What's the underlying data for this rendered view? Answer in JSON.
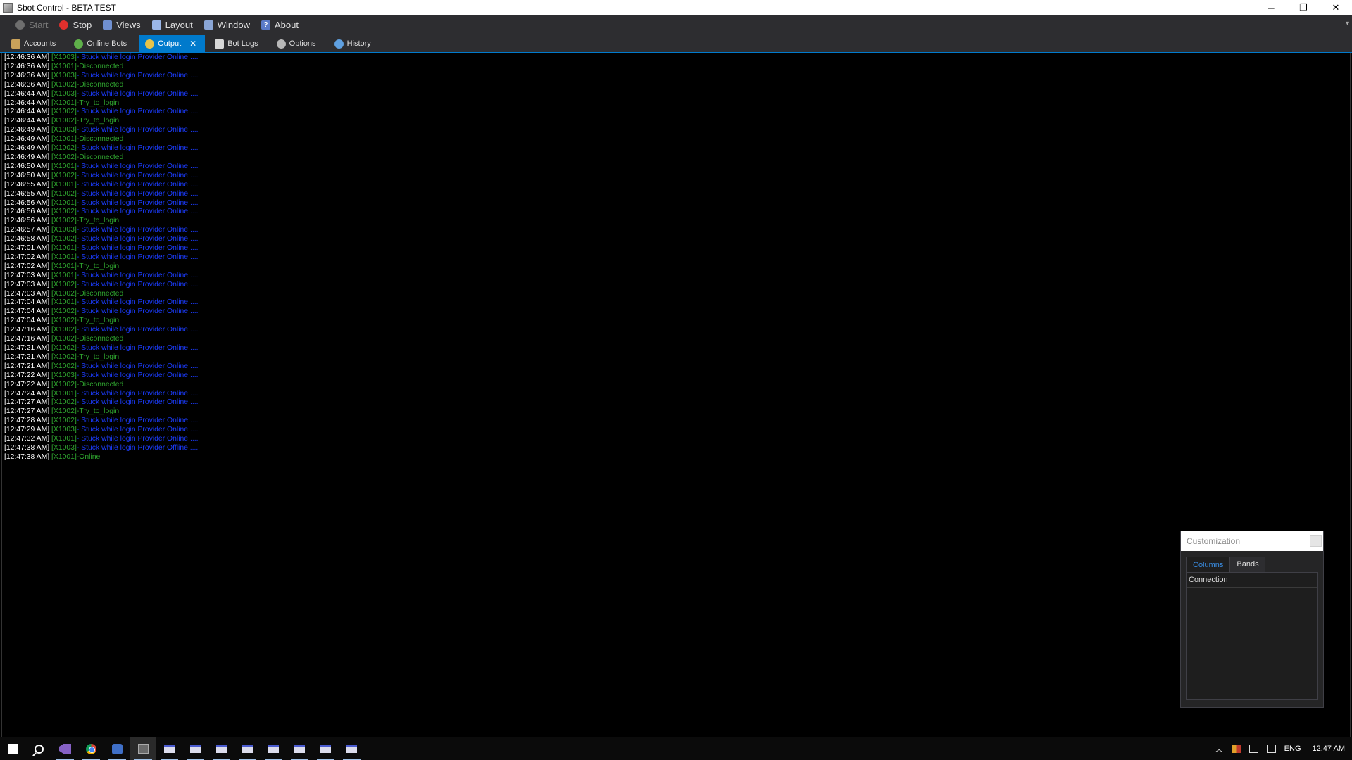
{
  "window": {
    "title": "Sbot Control - BETA TEST",
    "minimize": "─",
    "restore": "❐",
    "close": "✕"
  },
  "menu": [
    {
      "label": "Start",
      "icon": "start-icon",
      "enabled": false
    },
    {
      "label": "Stop",
      "icon": "stop-icon",
      "enabled": true
    },
    {
      "label": "Views",
      "icon": "views-icon",
      "enabled": true
    },
    {
      "label": "Layout",
      "icon": "layout-icon",
      "enabled": true
    },
    {
      "label": "Window",
      "icon": "window-icon",
      "enabled": true
    },
    {
      "label": "About",
      "icon": "about-icon",
      "enabled": true
    }
  ],
  "menu_overflow": "▾",
  "tabs": [
    {
      "label": "Accounts",
      "icon": "accounts-icon",
      "active": false
    },
    {
      "label": "Online Bots",
      "icon": "online-bots-icon",
      "active": false
    },
    {
      "label": "Output",
      "icon": "output-icon",
      "active": true
    },
    {
      "label": "Bot Logs",
      "icon": "bot-logs-icon",
      "active": false
    },
    {
      "label": "Options",
      "icon": "options-icon",
      "active": false
    },
    {
      "label": "History",
      "icon": "history-icon",
      "active": false
    }
  ],
  "tab_close": "✕",
  "tab_dropdown": "▼",
  "log": [
    {
      "time": "[12:46:36 AM]",
      "id": "[X1003]",
      "msg": "- Stuck while login Provider Online ....",
      "color": "blue"
    },
    {
      "time": "[12:46:36 AM]",
      "id": "[X1001]",
      "msg": "-Disconnected",
      "color": "green"
    },
    {
      "time": "[12:46:36 AM]",
      "id": "[X1003]",
      "msg": "- Stuck while login Provider Online ....",
      "color": "blue"
    },
    {
      "time": "[12:46:36 AM]",
      "id": "[X1002]",
      "msg": "-Disconnected",
      "color": "green"
    },
    {
      "time": "[12:46:44 AM]",
      "id": "[X1003]",
      "msg": "- Stuck while login Provider Online ....",
      "color": "blue"
    },
    {
      "time": "[12:46:44 AM]",
      "id": "[X1001]",
      "msg": "-Try_to_login",
      "color": "green"
    },
    {
      "time": "[12:46:44 AM]",
      "id": "[X1002]",
      "msg": "- Stuck while login Provider Online ....",
      "color": "blue"
    },
    {
      "time": "[12:46:44 AM]",
      "id": "[X1002]",
      "msg": "-Try_to_login",
      "color": "green"
    },
    {
      "time": "[12:46:49 AM]",
      "id": "[X1003]",
      "msg": "- Stuck while login Provider Online ....",
      "color": "blue"
    },
    {
      "time": "[12:46:49 AM]",
      "id": "[X1001]",
      "msg": "-Disconnected",
      "color": "green"
    },
    {
      "time": "[12:46:49 AM]",
      "id": "[X1002]",
      "msg": "- Stuck while login Provider Online ....",
      "color": "blue"
    },
    {
      "time": "[12:46:49 AM]",
      "id": "[X1002]",
      "msg": "-Disconnected",
      "color": "green"
    },
    {
      "time": "[12:46:50 AM]",
      "id": "[X1001]",
      "msg": "- Stuck while login Provider Online ....",
      "color": "blue"
    },
    {
      "time": "[12:46:50 AM]",
      "id": "[X1002]",
      "msg": "- Stuck while login Provider Online ....",
      "color": "blue"
    },
    {
      "time": "[12:46:55 AM]",
      "id": "[X1001]",
      "msg": "- Stuck while login Provider Online ....",
      "color": "blue"
    },
    {
      "time": "[12:46:55 AM]",
      "id": "[X1002]",
      "msg": "- Stuck while login Provider Online ....",
      "color": "blue"
    },
    {
      "time": "[12:46:56 AM]",
      "id": "[X1001]",
      "msg": "- Stuck while login Provider Online ....",
      "color": "blue"
    },
    {
      "time": "[12:46:56 AM]",
      "id": "[X1002]",
      "msg": "- Stuck while login Provider Online ....",
      "color": "blue"
    },
    {
      "time": "[12:46:56 AM]",
      "id": "[X1002]",
      "msg": "-Try_to_login",
      "color": "green"
    },
    {
      "time": "[12:46:57 AM]",
      "id": "[X1003]",
      "msg": "- Stuck while login Provider Online ....",
      "color": "blue"
    },
    {
      "time": "[12:46:58 AM]",
      "id": "[X1002]",
      "msg": "- Stuck while login Provider Online ....",
      "color": "blue"
    },
    {
      "time": "[12:47:01 AM]",
      "id": "[X1001]",
      "msg": "- Stuck while login Provider Online ....",
      "color": "blue"
    },
    {
      "time": "[12:47:02 AM]",
      "id": "[X1001]",
      "msg": "- Stuck while login Provider Online ....",
      "color": "blue"
    },
    {
      "time": "[12:47:02 AM]",
      "id": "[X1001]",
      "msg": "-Try_to_login",
      "color": "green"
    },
    {
      "time": "[12:47:03 AM]",
      "id": "[X1001]",
      "msg": "- Stuck while login Provider Online ....",
      "color": "blue"
    },
    {
      "time": "[12:47:03 AM]",
      "id": "[X1002]",
      "msg": "- Stuck while login Provider Online ....",
      "color": "blue"
    },
    {
      "time": "[12:47:03 AM]",
      "id": "[X1002]",
      "msg": "-Disconnected",
      "color": "green"
    },
    {
      "time": "[12:47:04 AM]",
      "id": "[X1001]",
      "msg": "- Stuck while login Provider Online ....",
      "color": "blue"
    },
    {
      "time": "[12:47:04 AM]",
      "id": "[X1002]",
      "msg": "- Stuck while login Provider Online ....",
      "color": "blue"
    },
    {
      "time": "[12:47:04 AM]",
      "id": "[X1002]",
      "msg": "-Try_to_login",
      "color": "green"
    },
    {
      "time": "[12:47:16 AM]",
      "id": "[X1002]",
      "msg": "- Stuck while login Provider Online ....",
      "color": "blue"
    },
    {
      "time": "[12:47:16 AM]",
      "id": "[X1002]",
      "msg": "-Disconnected",
      "color": "green"
    },
    {
      "time": "[12:47:21 AM]",
      "id": "[X1002]",
      "msg": "- Stuck while login Provider Online ....",
      "color": "blue"
    },
    {
      "time": "[12:47:21 AM]",
      "id": "[X1002]",
      "msg": "-Try_to_login",
      "color": "green"
    },
    {
      "time": "[12:47:21 AM]",
      "id": "[X1002]",
      "msg": "- Stuck while login Provider Online ....",
      "color": "blue"
    },
    {
      "time": "[12:47:22 AM]",
      "id": "[X1003]",
      "msg": "- Stuck while login Provider Online ....",
      "color": "blue"
    },
    {
      "time": "[12:47:22 AM]",
      "id": "[X1002]",
      "msg": "-Disconnected",
      "color": "green"
    },
    {
      "time": "[12:47:24 AM]",
      "id": "[X1001]",
      "msg": "- Stuck while login Provider Online ....",
      "color": "blue"
    },
    {
      "time": "[12:47:27 AM]",
      "id": "[X1002]",
      "msg": "- Stuck while login Provider Online ....",
      "color": "blue"
    },
    {
      "time": "[12:47:27 AM]",
      "id": "[X1002]",
      "msg": "-Try_to_login",
      "color": "green"
    },
    {
      "time": "[12:47:28 AM]",
      "id": "[X1002]",
      "msg": "- Stuck while login Provider Online ....",
      "color": "blue"
    },
    {
      "time": "[12:47:29 AM]",
      "id": "[X1003]",
      "msg": "- Stuck while login Provider Online ....",
      "color": "blue"
    },
    {
      "time": "[12:47:32 AM]",
      "id": "[X1001]",
      "msg": "- Stuck while login Provider Online ....",
      "color": "blue"
    },
    {
      "time": "[12:47:38 AM]",
      "id": "[X1003]",
      "msg": "- Stuck while login Provider Offline ....",
      "color": "blue"
    },
    {
      "time": "[12:47:38 AM]",
      "id": "[X1001]",
      "msg": "-Online",
      "color": "green"
    }
  ],
  "customization": {
    "title": "Customization",
    "tabs": [
      {
        "label": "Columns",
        "active": true
      },
      {
        "label": "Bands",
        "active": false
      }
    ],
    "items": [
      "Connection"
    ]
  },
  "taskbar": {
    "apps": [
      {
        "name": "start-button",
        "icon": "windows-logo-icon"
      },
      {
        "name": "search-button",
        "icon": "search-icon"
      },
      {
        "name": "visual-studio",
        "icon": "visual-studio-icon",
        "open": true
      },
      {
        "name": "chrome",
        "icon": "chrome-icon",
        "open": true
      },
      {
        "name": "app",
        "icon": "app-icon",
        "open": true
      },
      {
        "name": "sbot-control",
        "icon": "sbot-icon",
        "open": true,
        "active": true
      },
      {
        "name": "window-1",
        "icon": "window-icon",
        "open": true
      },
      {
        "name": "window-2",
        "icon": "window-icon",
        "open": true
      },
      {
        "name": "window-3",
        "icon": "window-icon",
        "open": true
      },
      {
        "name": "window-4",
        "icon": "window-icon",
        "open": true
      },
      {
        "name": "window-5",
        "icon": "window-icon",
        "open": true
      },
      {
        "name": "window-6",
        "icon": "window-icon",
        "open": true
      },
      {
        "name": "window-7",
        "icon": "window-icon",
        "open": true
      },
      {
        "name": "window-8",
        "icon": "window-icon",
        "open": true
      }
    ],
    "tray": {
      "chevron": "︿",
      "language": "ENG",
      "time": "12:47 AM"
    }
  }
}
